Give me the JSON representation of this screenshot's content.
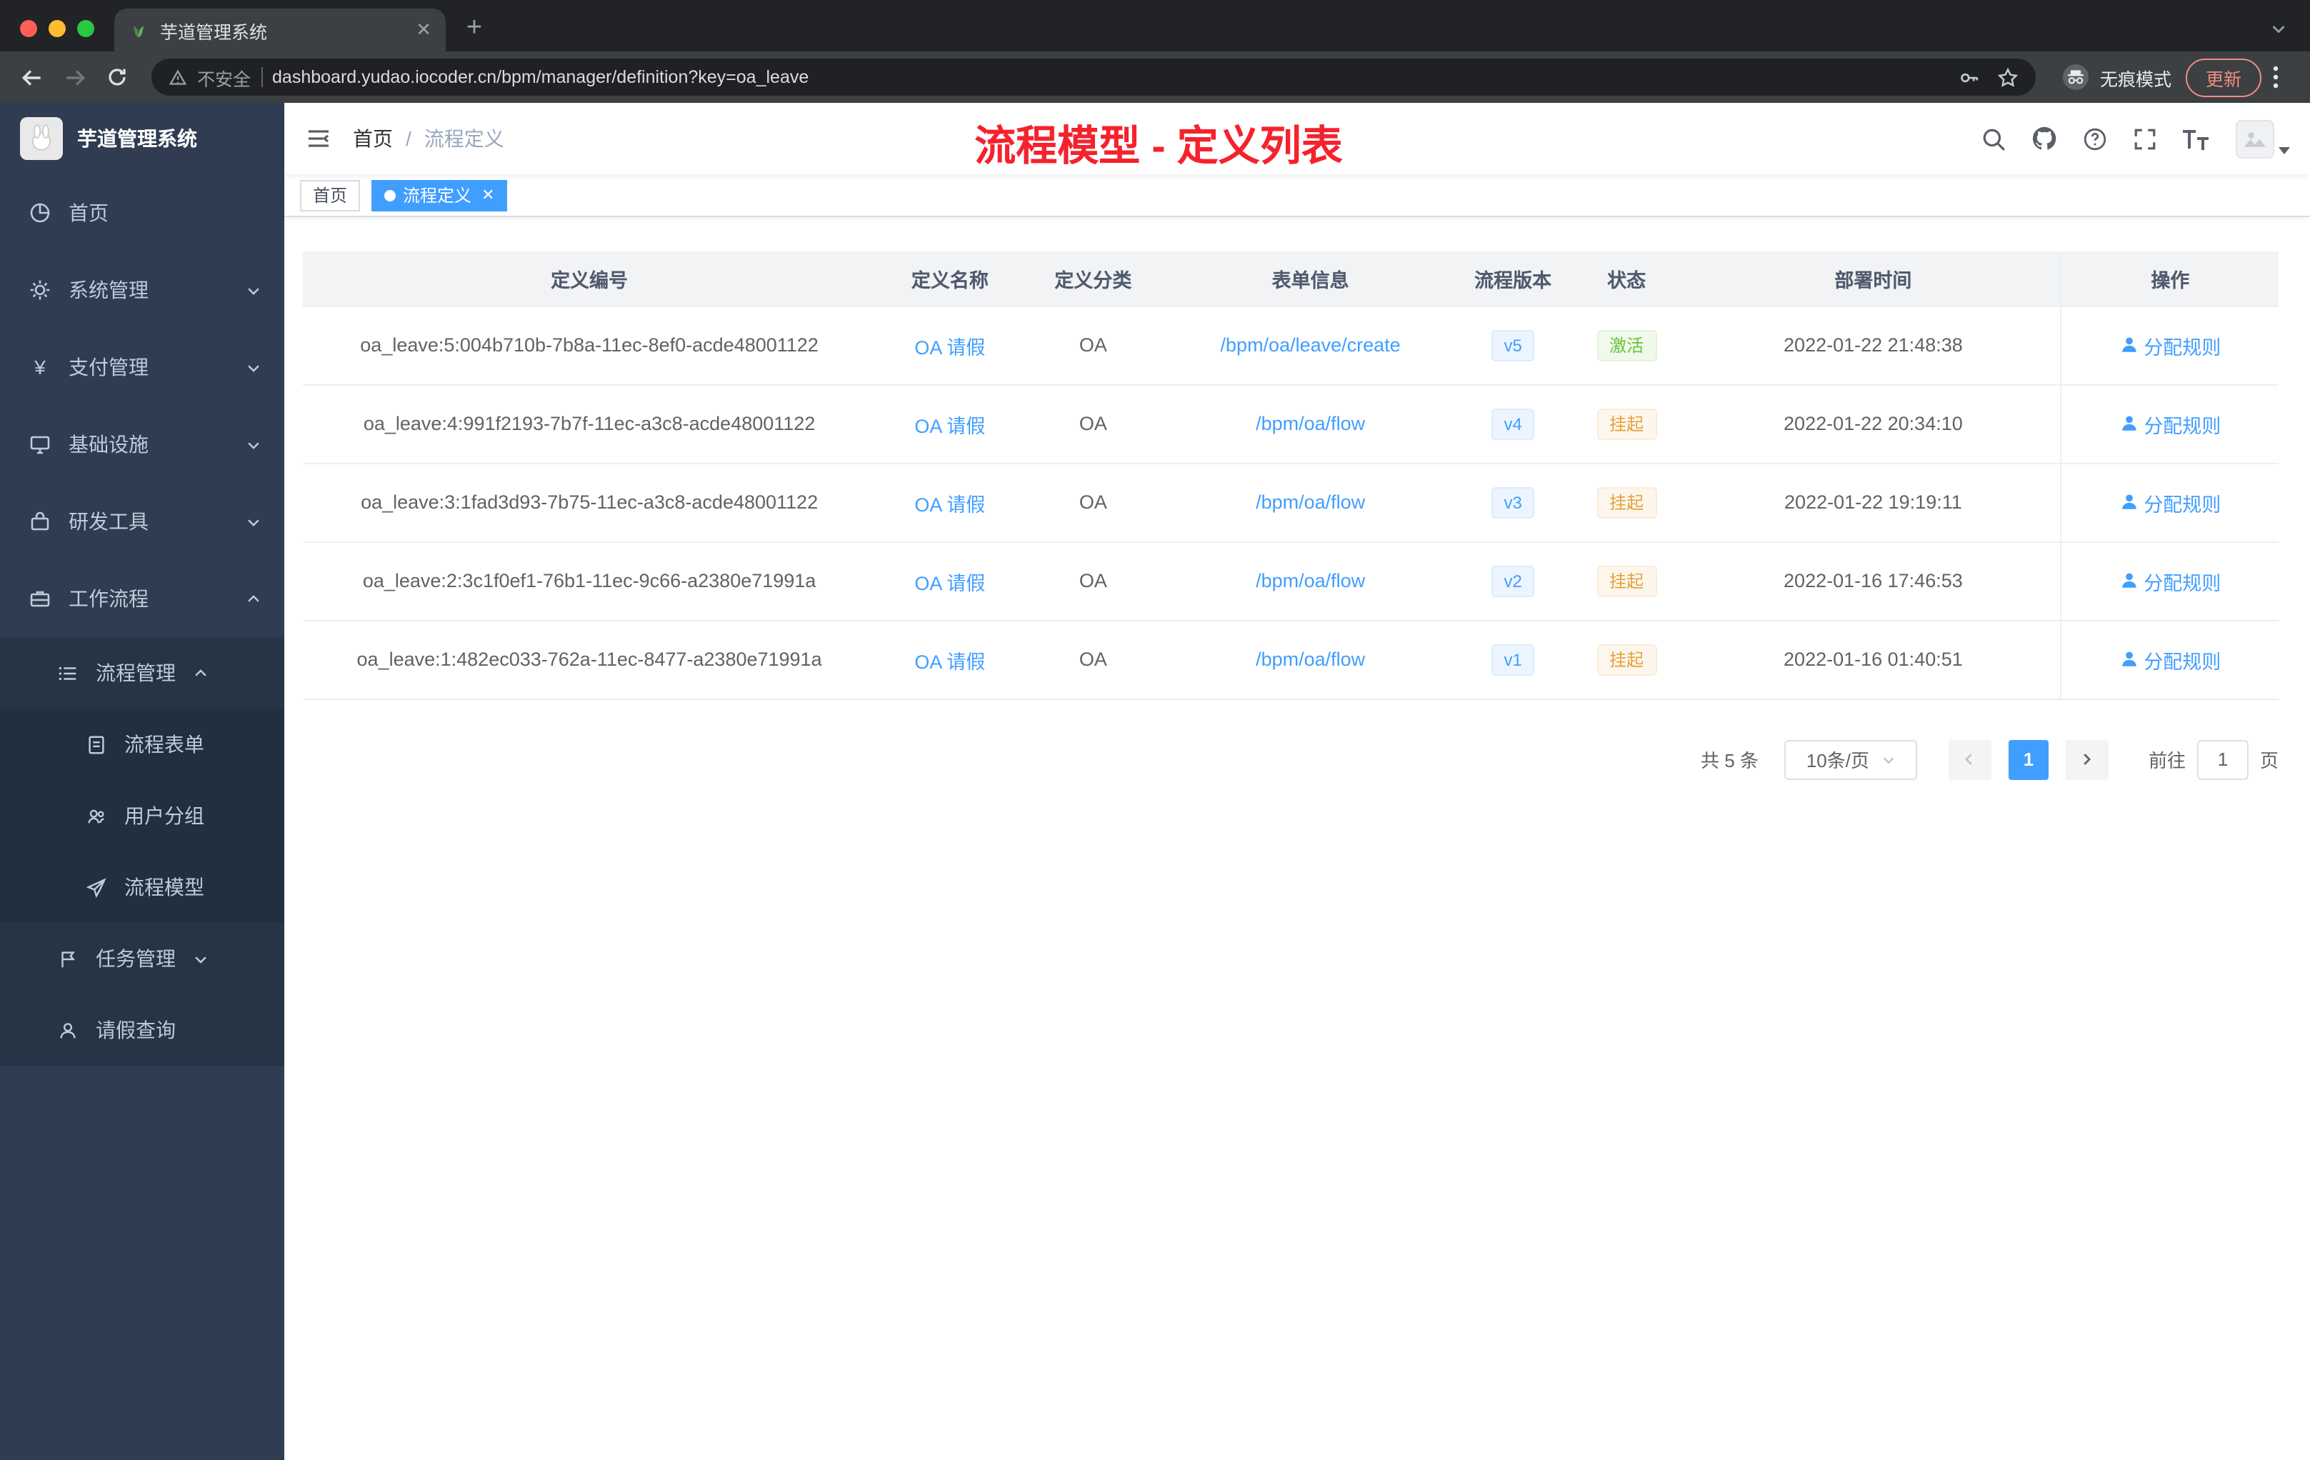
{
  "browser": {
    "tab_title": "芋道管理系统",
    "security_label": "不安全",
    "url": "dashboard.yudao.iocoder.cn/bpm/manager/definition?key=oa_leave",
    "incognito_label": "无痕模式",
    "update_label": "更新"
  },
  "sidebar": {
    "logo_title": "芋道管理系统",
    "items": [
      {
        "label": "首页"
      },
      {
        "label": "系统管理"
      },
      {
        "label": "支付管理"
      },
      {
        "label": "基础设施"
      },
      {
        "label": "研发工具"
      },
      {
        "label": "工作流程"
      },
      {
        "label": "流程管理"
      },
      {
        "label": "流程表单"
      },
      {
        "label": "用户分组"
      },
      {
        "label": "流程模型"
      },
      {
        "label": "任务管理"
      },
      {
        "label": "请假查询"
      }
    ]
  },
  "header": {
    "breadcrumb_home": "首页",
    "breadcrumb_current": "流程定义",
    "annotation": "流程模型 - 定义列表"
  },
  "tags": {
    "home": "首页",
    "active": "流程定义"
  },
  "table": {
    "columns": {
      "id": "定义编号",
      "name": "定义名称",
      "category": "定义分类",
      "form": "表单信息",
      "version": "流程版本",
      "status": "状态",
      "time": "部署时间",
      "action": "操作"
    },
    "action_label": "分配规则",
    "rows": [
      {
        "id": "oa_leave:5:004b710b-7b8a-11ec-8ef0-acde48001122",
        "name": "OA 请假",
        "category": "OA",
        "form": "/bpm/oa/leave/create",
        "version": "v5",
        "status": "激活",
        "time": "2022-01-22 21:48:38"
      },
      {
        "id": "oa_leave:4:991f2193-7b7f-11ec-a3c8-acde48001122",
        "name": "OA 请假",
        "category": "OA",
        "form": "/bpm/oa/flow",
        "version": "v4",
        "status": "挂起",
        "time": "2022-01-22 20:34:10"
      },
      {
        "id": "oa_leave:3:1fad3d93-7b75-11ec-a3c8-acde48001122",
        "name": "OA 请假",
        "category": "OA",
        "form": "/bpm/oa/flow",
        "version": "v3",
        "status": "挂起",
        "time": "2022-01-22 19:19:11"
      },
      {
        "id": "oa_leave:2:3c1f0ef1-76b1-11ec-9c66-a2380e71991a",
        "name": "OA 请假",
        "category": "OA",
        "form": "/bpm/oa/flow",
        "version": "v2",
        "status": "挂起",
        "time": "2022-01-16 17:46:53"
      },
      {
        "id": "oa_leave:1:482ec033-762a-11ec-8477-a2380e71991a",
        "name": "OA 请假",
        "category": "OA",
        "form": "/bpm/oa/flow",
        "version": "v1",
        "status": "挂起",
        "time": "2022-01-16 01:40:51"
      }
    ]
  },
  "pagination": {
    "total": "共 5 条",
    "page_size": "10条/页",
    "current_page": "1",
    "goto_label": "前往",
    "goto_value": "1",
    "unit_label": "页"
  },
  "colors": {
    "accent": "#409eff",
    "success": "#67c23a",
    "warning": "#e6a23c",
    "annotation_red": "#f5222d",
    "sidebar_bg": "#2f3c51"
  }
}
